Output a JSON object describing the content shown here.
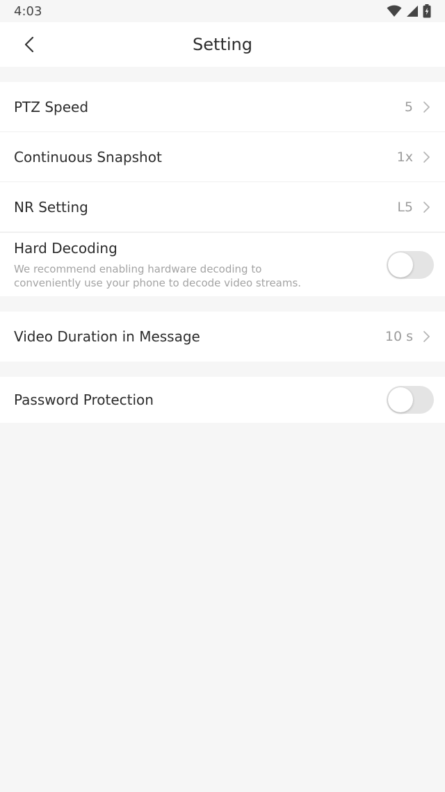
{
  "status_bar": {
    "time": "4:03",
    "icons": [
      "wifi-icon",
      "signal-icon",
      "battery-icon"
    ]
  },
  "header": {
    "title": "Setting",
    "back_icon": "chevron-left-icon"
  },
  "groups": [
    {
      "rows": [
        {
          "label": "PTZ Speed",
          "value": "5"
        },
        {
          "label": "Continuous Snapshot",
          "value": "1x"
        },
        {
          "label": "NR Setting",
          "value": "L5"
        }
      ]
    }
  ],
  "hard_decoding": {
    "label": "Hard Decoding",
    "description": "We recommend enabling hardware decoding to conveniently use your phone to decode video streams.",
    "enabled": false
  },
  "video_duration": {
    "label": "Video Duration in Message",
    "value": "10 s"
  },
  "password_protection": {
    "label": "Password Protection",
    "enabled": false
  },
  "colors": {
    "background": "#f6f6f6",
    "surface": "#ffffff",
    "text_primary": "#2b2b2b",
    "text_secondary": "#9b9b9b",
    "toggle_off": "#e4e4e4"
  }
}
